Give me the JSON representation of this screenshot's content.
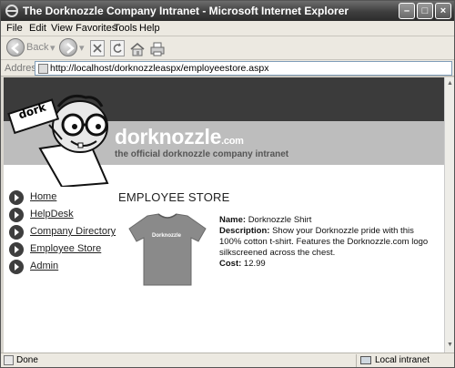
{
  "window": {
    "title": "The Dorknozzle Company Intranet - Microsoft Internet Explorer",
    "minimize_glyph": "–",
    "maximize_glyph": "□",
    "close_glyph": "×"
  },
  "menubar": {
    "items": [
      "File",
      "Edit",
      "View",
      "Favorites",
      "Tools",
      "Help"
    ]
  },
  "toolbar": {
    "back_label": "Back"
  },
  "address": {
    "label": "Address",
    "url": "http://localhost/dorknozzleaspx/employeestore.aspx"
  },
  "header": {
    "logo_text": "dorknozzle",
    "logo_suffix": ".com",
    "tagline": "the official dorknozzle company intranet",
    "mascot_tag": "dork"
  },
  "nav": {
    "items": [
      {
        "label": "Home"
      },
      {
        "label": "HelpDesk"
      },
      {
        "label": "Company Directory"
      },
      {
        "label": "Employee Store"
      },
      {
        "label": "Admin"
      }
    ]
  },
  "main": {
    "title": "EMPLOYEE STORE",
    "product": {
      "shirt_print": "Dorknozzle",
      "name_label": "Name:",
      "name": "Dorknozzle Shirt",
      "description_label": "Description:",
      "description_line1": "Show your Dorknozzle pride with this",
      "description_line2": "100% cotton t-shirt. Features the Dorknozzle.com logo",
      "description_line3": "silkscreened across the chest.",
      "cost_label": "Cost:",
      "cost": "12.99"
    }
  },
  "status": {
    "text": "Done",
    "zone": "Local intranet"
  }
}
